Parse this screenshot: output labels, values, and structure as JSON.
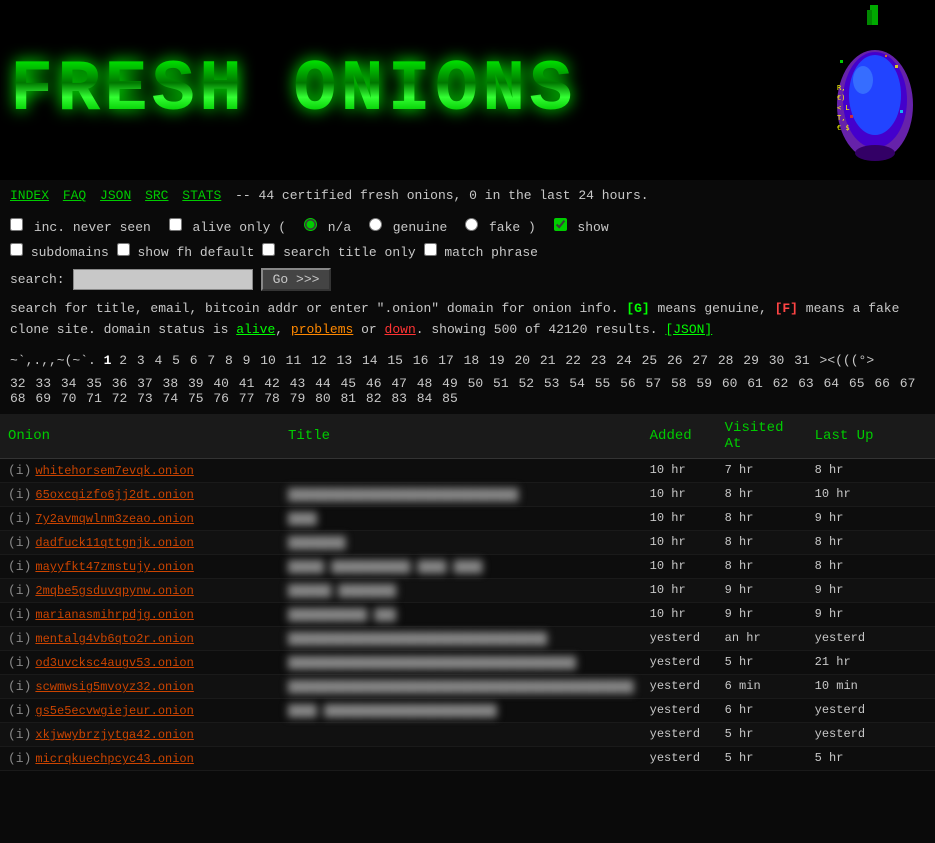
{
  "header": {
    "logo": "FRESH ONIONS",
    "tagline": "-- 44 certified fresh onions, 0 in the last 24 hours."
  },
  "navbar": {
    "links": [
      "INDEX",
      "FAQ",
      "JSON",
      "SRC",
      "STATS"
    ]
  },
  "controls": {
    "inc_never_seen_label": "inc. never seen",
    "alive_only_label": "alive only (",
    "na_label": "n/a",
    "genuine_label": "genuine",
    "fake_label": "fake )",
    "show_label": "show",
    "subdomains_label": "subdomains",
    "show_fh_default_label": "show fh default",
    "search_title_only_label": "search title only",
    "match_phrase_label": "match phrase",
    "inc_never_seen_checked": false,
    "alive_only_checked": false,
    "na_selected": true,
    "genuine_selected": false,
    "fake_selected": false,
    "show_checked": true,
    "subdomains_checked": false,
    "show_fh_default_checked": false,
    "search_title_only_checked": false,
    "match_phrase_checked": false
  },
  "search": {
    "label": "search:",
    "placeholder": "",
    "button_label": "Go >>>"
  },
  "info": {
    "text1": "search for title, email, bitcoin addr or enter \".onion\" domain for onion info.",
    "genuine_badge": "[G]",
    "text2": "means genuine,",
    "fake_badge": "[F]",
    "text3": "means a fake clone site. domain status is",
    "alive": "alive",
    "comma1": ",",
    "problems": "problems",
    "or": "or",
    "down": "down",
    "text4": ". showing 500 of 42120 results.",
    "json_link": "[JSON]"
  },
  "pagination": {
    "prefix": "~`,.,,~(~`. ",
    "current": "1",
    "pages": [
      "2",
      "3",
      "4",
      "5",
      "6",
      "7",
      "8",
      "9",
      "10",
      "11",
      "12",
      "13",
      "14",
      "15",
      "16",
      "17",
      "18",
      "19",
      "20",
      "21",
      "22",
      "23",
      "24",
      "25",
      "26",
      "27",
      "28",
      "29",
      "30",
      "31",
      "32",
      "33",
      "34",
      "35",
      "36",
      "37",
      "38",
      "39",
      "40",
      "41",
      "42",
      "43",
      "44",
      "45",
      "46",
      "47",
      "48",
      "49",
      "50",
      "51",
      "52",
      "53",
      "54",
      "55",
      "56",
      "57",
      "58",
      "59",
      "60",
      "61",
      "62",
      "63",
      "64",
      "65",
      "66",
      "67",
      "68",
      "69",
      "70",
      "71",
      "72",
      "73",
      "74",
      "75",
      "76",
      "77",
      "78",
      "79",
      "80",
      "81",
      "82",
      "83",
      "84",
      "85"
    ],
    "suffix": "><(((°>"
  },
  "table": {
    "headers": [
      "Onion",
      "Title",
      "Added",
      "Visited At",
      "Last Up"
    ],
    "rows": [
      {
        "info_link": "(i)",
        "onion": "whitehorsem7evqk.onion",
        "title": "",
        "title_blurred": true,
        "added": "10 hr",
        "visited": "7 hr",
        "last_up": "8 hr"
      },
      {
        "info_link": "(i)",
        "onion": "65oxcqizfo6jj2dt.onion",
        "title": "████████████████████████████████",
        "title_blurred": true,
        "added": "10 hr",
        "visited": "8 hr",
        "last_up": "10 hr"
      },
      {
        "info_link": "(i)",
        "onion": "7y2avmqwlnm3zeao.onion",
        "title": "████",
        "title_blurred": true,
        "added": "10 hr",
        "visited": "8 hr",
        "last_up": "9 hr"
      },
      {
        "info_link": "(i)",
        "onion": "dadfuck11qttgnjk.onion",
        "title": "████████",
        "title_blurred": true,
        "added": "10 hr",
        "visited": "8 hr",
        "last_up": "8 hr"
      },
      {
        "info_link": "(i)",
        "onion": "mayyfkt47zmstujy.onion",
        "title": "█████ ███████████ ████ ████",
        "title_blurred": true,
        "added": "10 hr",
        "visited": "8 hr",
        "last_up": "8 hr"
      },
      {
        "info_link": "(i)",
        "onion": "2mqbe5gsduvqpynw.onion",
        "title": "██████ ████████",
        "title_blurred": true,
        "added": "10 hr",
        "visited": "9 hr",
        "last_up": "9 hr",
        "gap": true
      },
      {
        "info_link": "(i)",
        "onion": "marianasmihrpdjg.onion",
        "title": "███████████ ███",
        "title_blurred": true,
        "added": "10 hr",
        "visited": "9 hr",
        "last_up": "9 hr"
      },
      {
        "info_link": "(i)",
        "onion": "mentalg4vb6qto2r.onion",
        "title": "████████████████████████████████████",
        "title_blurred": true,
        "added": "yesterd",
        "visited": "an hr",
        "last_up": "yesterd"
      },
      {
        "info_link": "(i)",
        "onion": "od3uvcksc4augv53.onion",
        "title": "████████████████████████████████████████",
        "title_blurred": true,
        "added": "yesterd",
        "visited": "5 hr",
        "last_up": "21 hr"
      },
      {
        "info_link": "(i)",
        "onion": "scwmwsig5mvoyz32.onion",
        "title": "████████████████████████████████████████████████",
        "title_blurred": true,
        "added": "yesterd",
        "visited": "6 min",
        "last_up": "10 min"
      },
      {
        "info_link": "(i)",
        "onion": "gs5e5ecvwgiejeur.onion",
        "title": "████ ████████████████████████",
        "title_blurred": true,
        "added": "yesterd",
        "visited": "6 hr",
        "last_up": "yesterd"
      },
      {
        "info_link": "(i)",
        "onion": "xkjwwybrzjytga42.onion",
        "title": "",
        "title_blurred": true,
        "added": "yesterd",
        "visited": "5 hr",
        "last_up": "yesterd"
      },
      {
        "info_link": "(i)",
        "onion": "micrqkuechpcyc43.onion",
        "title": "",
        "title_blurred": true,
        "added": "yesterd",
        "visited": "5 hr",
        "last_up": "5 hr"
      }
    ]
  }
}
